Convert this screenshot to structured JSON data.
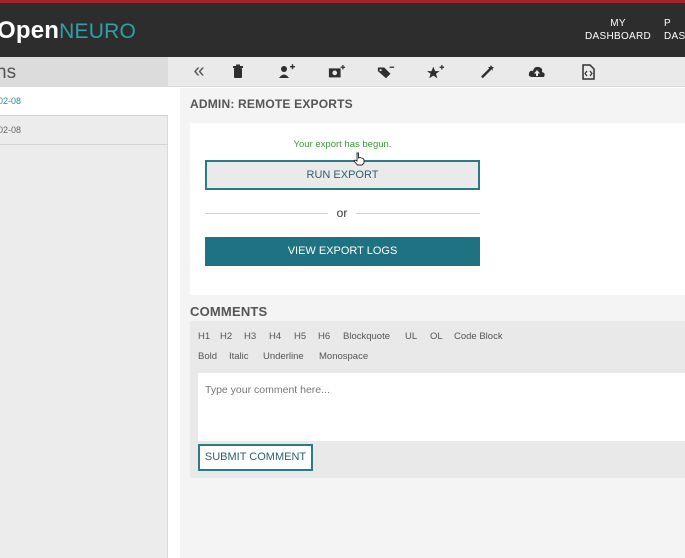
{
  "header": {
    "logo_open": "Open",
    "logo_neuro": "NEURO",
    "nav_my_line1": "MY",
    "nav_my_line2": "DASHBOARD",
    "nav_p_line1": "P",
    "nav_p_line2": "DAS"
  },
  "sidebar": {
    "title": "ns",
    "items": [
      {
        "label": "02-08",
        "active": true
      },
      {
        "label": "02-08",
        "active": false
      }
    ]
  },
  "toolbar": {
    "icons": [
      "trash-icon",
      "add-user-icon",
      "add-image-icon",
      "remove-tag-icon",
      "add-star-icon",
      "magic-wand-icon",
      "cloud-upload-icon",
      "code-file-icon"
    ]
  },
  "admin": {
    "title": "ADMIN: REMOTE EXPORTS",
    "status": "Your export has begun.",
    "run_label": "RUN EXPORT",
    "or_label": "or",
    "logs_label": "VIEW EXPORT LOGS"
  },
  "comments": {
    "title": "COMMENTS",
    "format_row1": [
      "H1",
      "H2",
      "H3",
      "H4",
      "H5",
      "H6",
      "Blockquote",
      "UL",
      "OL",
      "Code Block"
    ],
    "format_row2": [
      "Bold",
      "Italic",
      "Underline",
      "Monospace"
    ],
    "placeholder": "Type your comment here...",
    "submit_label": "SUBMIT COMMENT"
  },
  "colors": {
    "accent": "#1e7282",
    "success": "#3c9a35",
    "header_bg": "#2d2d2d",
    "brand_red": "#a3232a"
  }
}
